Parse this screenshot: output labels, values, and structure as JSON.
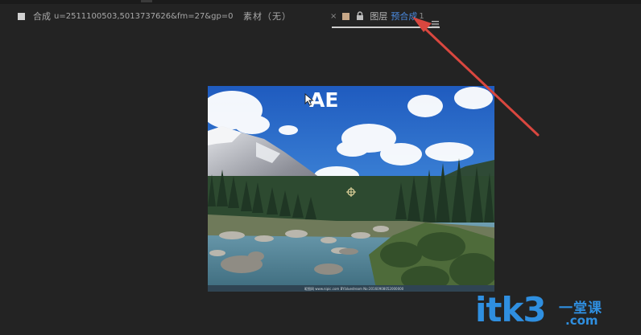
{
  "tabs": {
    "composition": {
      "label": "合成",
      "name": "u=2511100503,5013737626&fm=27&gp=0"
    },
    "source": {
      "label": "素材（无）"
    },
    "layer": {
      "close": "×",
      "label": "图层",
      "link": "预合成",
      "suffix": "1"
    }
  },
  "viewer": {
    "overlay_text": "AE",
    "photo_caption": "昵图网 www.nipic.com BY:bluedream No:20160908052000000"
  },
  "icons": {
    "comp_swatch": "composition-swatch-icon",
    "layer_swatch": "layer-swatch-icon",
    "lock": "lock-icon",
    "menu": "panel-menu-icon",
    "cursor": "cursor-arrow-icon",
    "anchor": "anchor-point-icon"
  },
  "colors": {
    "accent": "#4b8be0",
    "arrow": "#d9473f",
    "watermark": "#2f8fe0",
    "background": "#232323"
  },
  "watermark": {
    "main": "itk3",
    "cn": "一堂课",
    "com": ".com"
  }
}
